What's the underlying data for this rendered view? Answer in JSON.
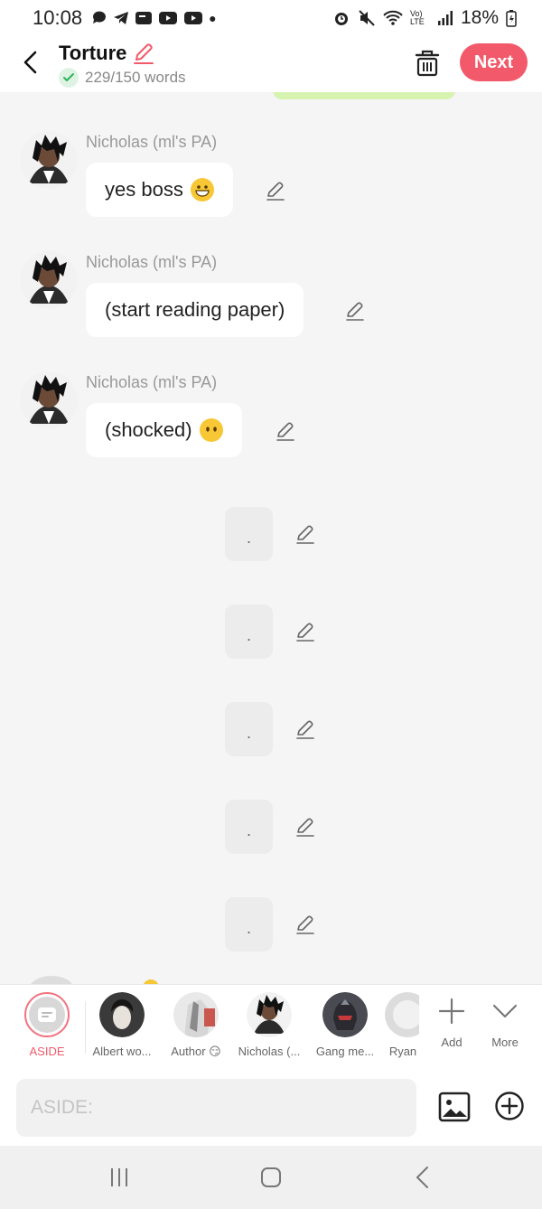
{
  "status_bar": {
    "time": "10:08",
    "battery": "18%",
    "network_label": "Vo) LTE"
  },
  "header": {
    "title": "Torture",
    "word_count": "229/150 words",
    "next_label": "Next"
  },
  "messages": [
    {
      "sender": "Nicholas (ml's PA)",
      "text": "yes boss",
      "emoji": "grinning-face"
    },
    {
      "sender": "Nicholas (ml's PA)",
      "text": "(start reading paper)",
      "emoji": ""
    },
    {
      "sender": "Nicholas (ml's PA)",
      "text": "(shocked)",
      "emoji": "no-mouth-face"
    }
  ],
  "dot_messages": [
    {
      "text": "."
    },
    {
      "text": "."
    },
    {
      "text": "."
    },
    {
      "text": "."
    },
    {
      "text": "."
    }
  ],
  "characters": [
    {
      "label": "ASIDE",
      "selected": true
    },
    {
      "label": "Albert wo..."
    },
    {
      "label": "Author 😏"
    },
    {
      "label": "Nicholas (..."
    },
    {
      "label": "Gang me..."
    },
    {
      "label": "Ryan"
    }
  ],
  "tools": {
    "add_label": "Add",
    "more_label": "More"
  },
  "input": {
    "placeholder": "ASIDE:",
    "value": ""
  },
  "colors": {
    "accent": "#f25a6b",
    "background": "#f5f5f5",
    "bubble": "#ffffff",
    "dot_bubble": "#ececec",
    "success": "#2fb35c"
  }
}
